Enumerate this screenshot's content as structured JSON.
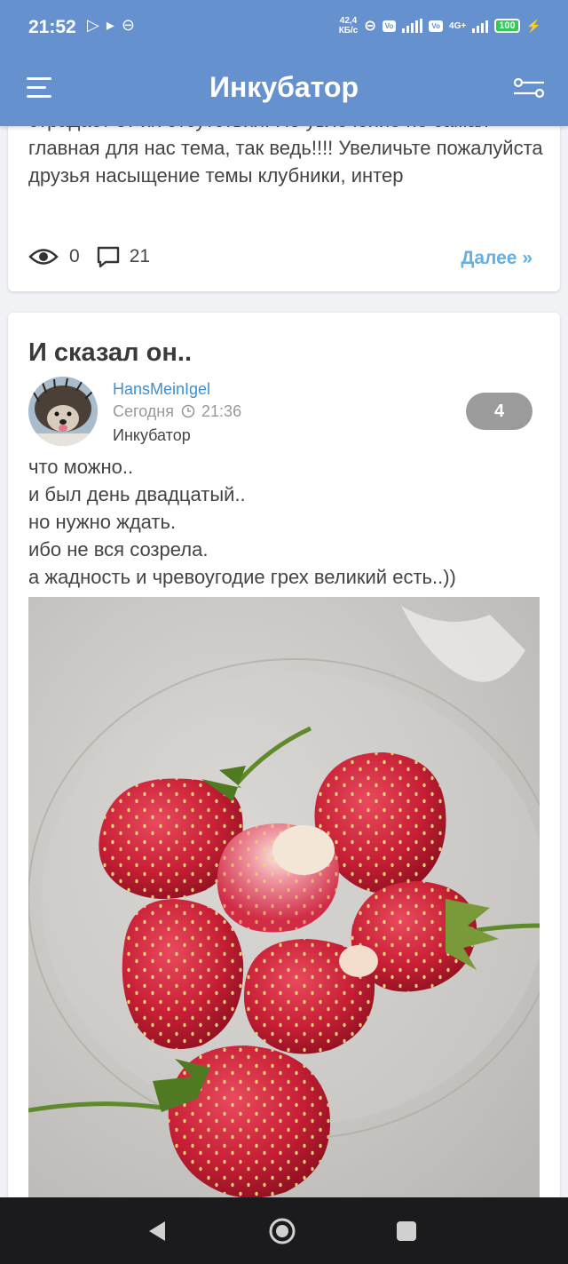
{
  "status_bar": {
    "time": "21:52",
    "net_speed_value": "42,4",
    "net_speed_unit": "КБ/с",
    "net_type": "4G+",
    "battery": "100"
  },
  "app_bar": {
    "title": "Инкубатор"
  },
  "previous_post": {
    "excerpt_cut": "страдает от их отсутствия. Но увлечение не самая",
    "excerpt": "главная для нас тема, так ведь!!!! Увеличьте пожалуйста друзья насыщение темы клубники, интер",
    "views": "0",
    "comments": "21",
    "more_label": "Далее »"
  },
  "post": {
    "title": "И сказал он..",
    "author": "HansMeinIgel",
    "date_label": "Сегодня",
    "time": "21:36",
    "category": "Инкубатор",
    "badge_count": "4",
    "lines": [
      "что можно..",
      "и был день двадцатый..",
      "но нужно ждать.",
      "ибо не вся созрела.",
      "а жадность и чревоугодие грех великий есть..))"
    ]
  },
  "colors": {
    "accent": "#6691cf",
    "link": "#3e8ed0",
    "more": "#65afe2",
    "badge": "#9b9b9b"
  }
}
